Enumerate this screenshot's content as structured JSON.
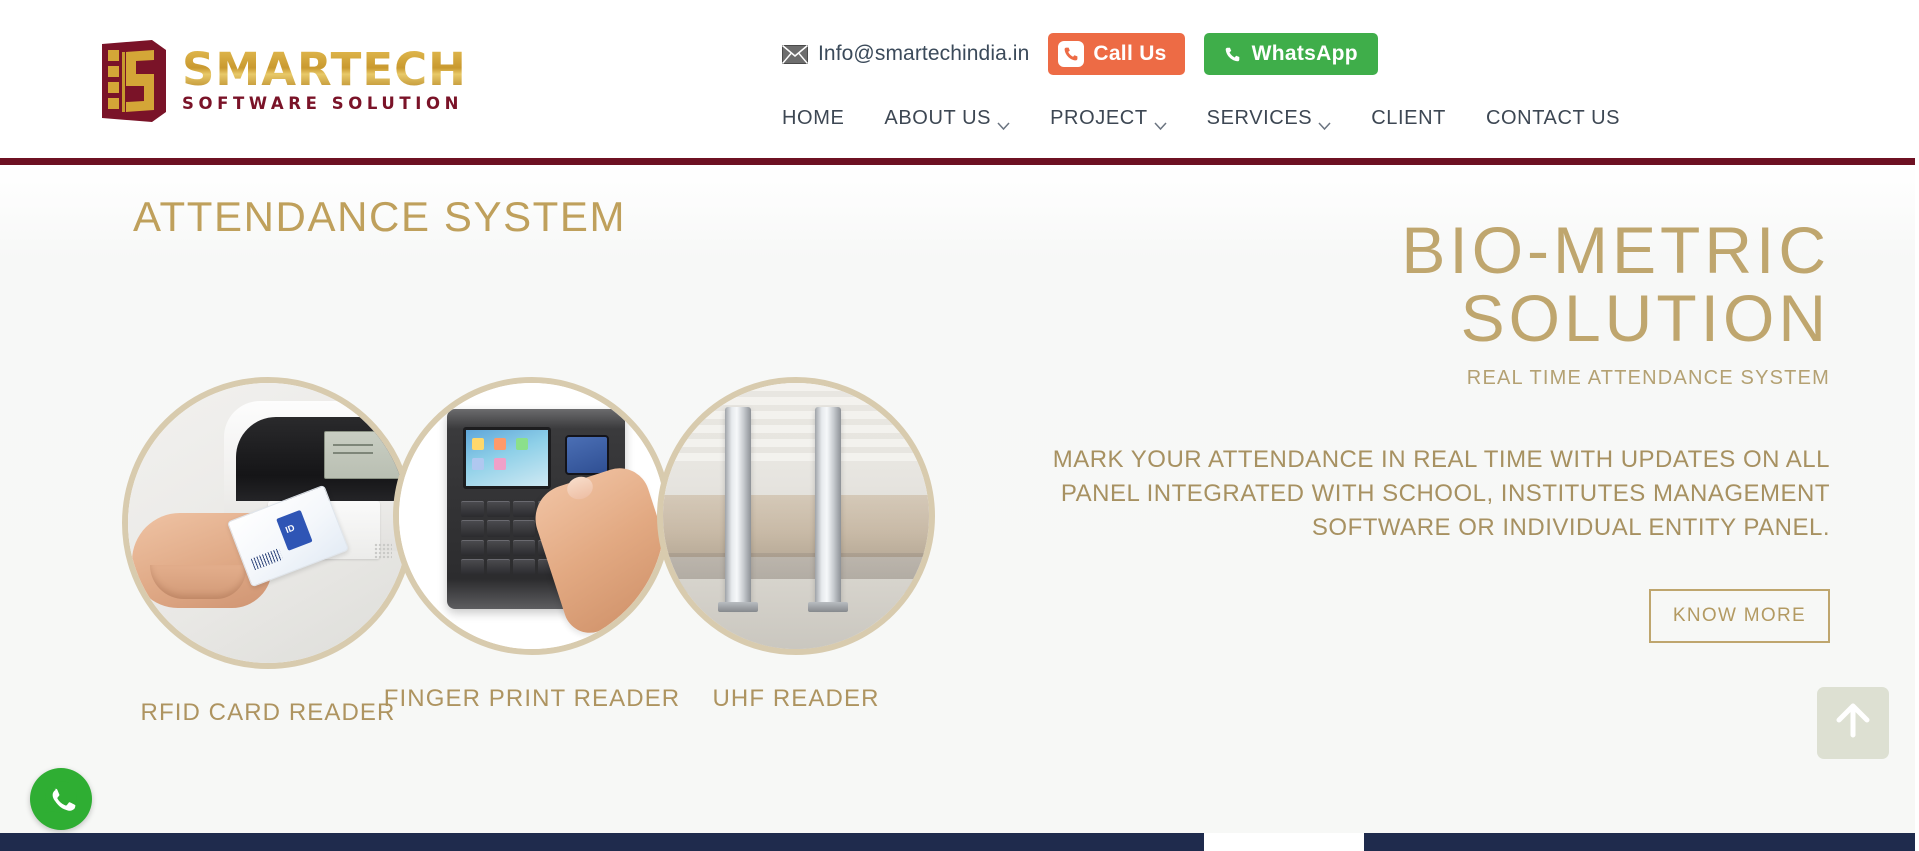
{
  "header": {
    "logo": {
      "main": "SMARTECH",
      "sub": "SOFTWARE SOLUTION",
      "gold": "#C9992F",
      "maroon": "#7A1328"
    },
    "contact": {
      "email": "Info@smartechindia.in",
      "call_label": "Call Us",
      "whatsapp_label": "WhatsApp",
      "call_color": "#ED6B45",
      "whatsapp_color": "#3FAE4A"
    },
    "nav": [
      {
        "label": "HOME",
        "caret": false
      },
      {
        "label": "ABOUT US",
        "caret": true
      },
      {
        "label": "PROJECT",
        "caret": true
      },
      {
        "label": "SERVICES",
        "caret": true
      },
      {
        "label": "CLIENT",
        "caret": false
      },
      {
        "label": "CONTACT US",
        "caret": false
      }
    ],
    "rule_color": "#6E1123"
  },
  "hero": {
    "section_title": "ATTENDANCE SYSTEM",
    "accent_color": "#BFA05C",
    "products": [
      {
        "label": "RFID CARD READER",
        "image": "rfid-card-reader-photo"
      },
      {
        "label": "FINGER PRINT READER",
        "image": "fingerprint-reader-photo"
      },
      {
        "label": "UHF READER",
        "image": "uhf-gate-reader-photo"
      }
    ],
    "headline_line1": "BIO-METRIC",
    "headline_line2": "SOLUTION",
    "subheadline": "REAL TIME ATTENDANCE SYSTEM",
    "paragraph": "MARK YOUR ATTENDANCE IN REAL TIME WITH UPDATES ON ALL PANEL INTEGRATED WITH SCHOOL, INSTITUTES MANAGEMENT SOFTWARE OR INDIVIDUAL ENTITY PANEL.",
    "cta_label": "KNOW MORE"
  },
  "floating": {
    "whatsapp_icon": "whatsapp-icon",
    "scroll_top_icon": "arrow-up-icon"
  }
}
